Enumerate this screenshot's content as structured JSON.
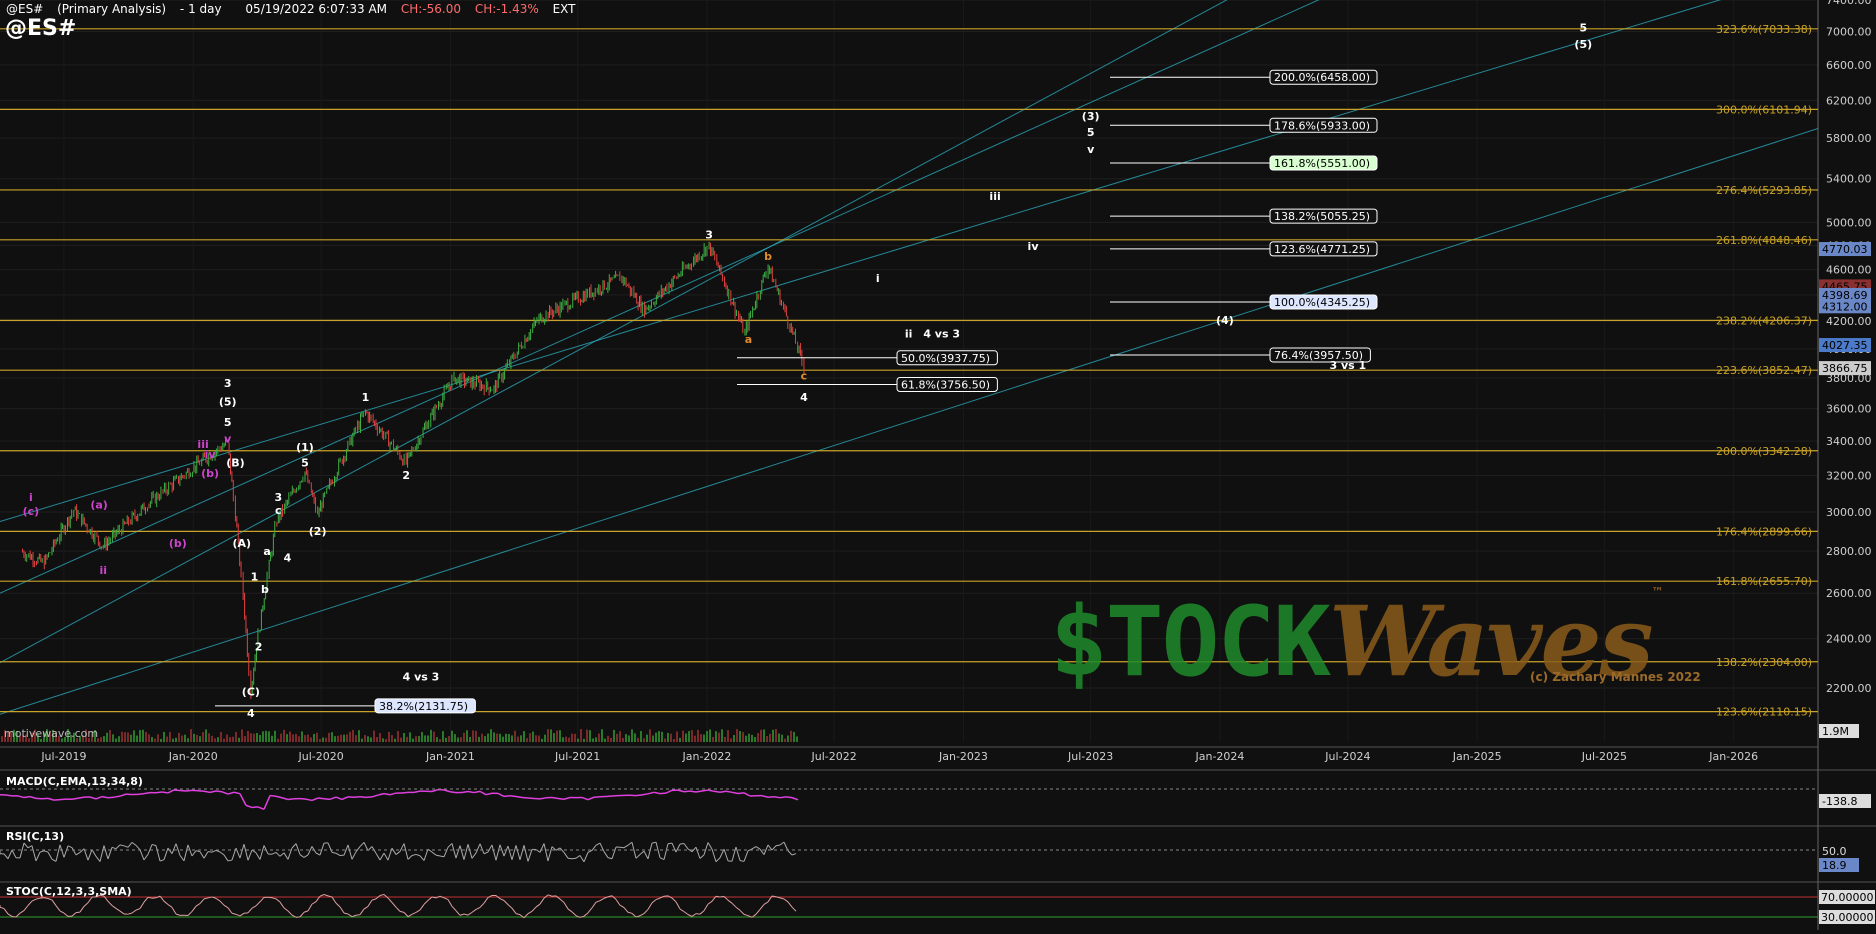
{
  "header": {
    "symbol": "@ES#",
    "study": "(Primary Analysis)",
    "interval": "1 day",
    "timestamp": "05/19/2022 6:07:33 AM",
    "change": "CH:-56.00",
    "change_pct": "CH:-1.43%",
    "session": "EXT",
    "big_symbol": "@ES#"
  },
  "source_label": "motivewave.com",
  "brand": {
    "left": "$TOCK",
    "right": "Waves",
    "tm": "™",
    "copyright": "(c) Zachary Mannes 2022"
  },
  "colors": {
    "background": "#101010",
    "fib_line": "#c9a227",
    "channel": "#2aa7b8",
    "bull_candle": "#3cb043",
    "bear_candle": "#e04040",
    "macd": "#e040e0",
    "grid": "#222222"
  },
  "chart_data": {
    "type": "candlestick",
    "y_scale": "log",
    "ylim": [
      2000,
      7400
    ],
    "x_axis": {
      "ticks": [
        "Jul-2019",
        "Jan-2020",
        "Jul-2020",
        "Jan-2021",
        "Jul-2021",
        "Jan-2022",
        "Jul-2022",
        "Jan-2023",
        "Jul-2023",
        "Jan-2024",
        "Jul-2024",
        "Jan-2025",
        "Jul-2025",
        "Jan-2026"
      ]
    },
    "y_axis": {
      "ticks": [
        2200,
        2400,
        2600,
        2800,
        3000,
        3200,
        3400,
        3600,
        3800,
        4000,
        4200,
        4400,
        4600,
        4800,
        5000,
        5400,
        5800,
        6200,
        6600,
        7000,
        7400
      ],
      "tick_labels": [
        "2200.00",
        "2400.00",
        "2600.00",
        "2800.00",
        "3000.00",
        "3200.00",
        "3400.00",
        "3600.00",
        "3800.00",
        "4000.00",
        "4200.00",
        "4400.00",
        "4600.00",
        "4800.00",
        "5000.00",
        "5400.00",
        "5800.00",
        "6200.00",
        "6600.00",
        "7000.00",
        "7400.00"
      ]
    },
    "price_path": [
      [
        "2019-05-01",
        2800
      ],
      [
        "2019-06-03",
        2740
      ],
      [
        "2019-07-15",
        3010
      ],
      [
        "2019-08-26",
        2825
      ],
      [
        "2019-10-28",
        3040
      ],
      [
        "2019-12-31",
        3240
      ],
      [
        "2020-02-19",
        3390
      ],
      [
        "2020-03-23",
        2190
      ],
      [
        "2020-04-29",
        2950
      ],
      [
        "2020-06-08",
        3220
      ],
      [
        "2020-06-26",
        2990
      ],
      [
        "2020-09-02",
        3580
      ],
      [
        "2020-10-30",
        3270
      ],
      [
        "2021-01-06",
        3800
      ],
      [
        "2021-03-04",
        3730
      ],
      [
        "2021-05-07",
        4220
      ],
      [
        "2021-09-02",
        4540
      ],
      [
        "2021-10-04",
        4280
      ],
      [
        "2022-01-04",
        4800
      ],
      [
        "2022-02-24",
        4110
      ],
      [
        "2022-03-29",
        4630
      ],
      [
        "2022-05-19",
        3880
      ]
    ],
    "fib_levels": [
      {
        "label": "323.6%(7033.38)",
        "value": 7033.38
      },
      {
        "label": "300.0%(6101.94)",
        "value": 6101.94
      },
      {
        "label": "276.4%(5293.85)",
        "value": 5293.85
      },
      {
        "label": "261.8%(4848.46)",
        "value": 4848.46
      },
      {
        "label": "238.2%(4206.37)",
        "value": 4206.37
      },
      {
        "label": "223.6%(3852.47)",
        "value": 3852.47
      },
      {
        "label": "200.0%(3342.28)",
        "value": 3342.28
      },
      {
        "label": "176.4%(2899.66)",
        "value": 2899.66
      },
      {
        "label": "161.8%(2655.70)",
        "value": 2655.7
      },
      {
        "label": "138.2%(2304.00)",
        "value": 2304.0
      },
      {
        "label": "123.6%(2110.15)",
        "value": 2110.15
      }
    ],
    "targets": [
      {
        "label": "200.0%(6458.00)",
        "value": 6458.0,
        "highlight": false
      },
      {
        "label": "178.6%(5933.00)",
        "value": 5933.0,
        "highlight": false
      },
      {
        "label": "161.8%(5551.00)",
        "value": 5551.0,
        "highlight": true
      },
      {
        "label": "138.2%(5055.25)",
        "value": 5055.25,
        "highlight": false
      },
      {
        "label": "123.6%(4771.25)",
        "value": 4771.25,
        "highlight": false
      },
      {
        "label": "100.0%(4345.25)",
        "value": 4345.25,
        "highlight": "blue"
      },
      {
        "label": "76.4%(3957.50)",
        "value": 3957.5,
        "highlight": false
      }
    ],
    "retracements": [
      {
        "label": "50.0%(3937.75)",
        "value": 3937.75
      },
      {
        "label": "61.8%(3756.50)",
        "value": 3756.5
      },
      {
        "label": "38.2%(2131.75)",
        "value": 2131.75
      }
    ],
    "price_badges": [
      {
        "label": "4770.03",
        "value": 4770.03,
        "color": "#6a88c8"
      },
      {
        "label": "4465.75",
        "value": 4465.75,
        "color": "#8a3030"
      },
      {
        "label": "4398.69",
        "value": 4398.69,
        "color": "#6a88c8"
      },
      {
        "label": "4312.00",
        "value": 4312.0,
        "color": "#6a88c8"
      },
      {
        "label": "4027.35",
        "value": 4027.35,
        "color": "#4a7ac8"
      },
      {
        "label": "3866.75",
        "value": 3866.75,
        "color": "#cccccc"
      }
    ],
    "wave_labels": [
      {
        "text": "3",
        "date": "2022-01-04",
        "value": 4860,
        "color": "#ffffff"
      },
      {
        "text": "b",
        "date": "2022-03-29",
        "value": 4680,
        "color": "#e08a2a"
      },
      {
        "text": "a",
        "date": "2022-03-01",
        "value": 4040,
        "color": "#e08a2a"
      },
      {
        "text": "c",
        "date": "2022-05-19",
        "value": 3790,
        "color": "#e08a2a"
      },
      {
        "text": "4",
        "date": "2022-05-19",
        "value": 3650,
        "color": "#ffffff"
      },
      {
        "text": "i",
        "date": "2022-09-01",
        "value": 4500,
        "color": "#ffffff"
      },
      {
        "text": "ii",
        "date": "2022-10-15",
        "value": 4080,
        "color": "#ffffff"
      },
      {
        "text": "4 vs 3",
        "date": "2022-12-01",
        "value": 4080,
        "color": "#ffffff"
      },
      {
        "text": "iii",
        "date": "2023-02-15",
        "value": 5200,
        "color": "#ffffff"
      },
      {
        "text": "iv",
        "date": "2023-04-10",
        "value": 4760,
        "color": "#ffffff"
      },
      {
        "text": "(3)",
        "date": "2023-07-01",
        "value": 5990,
        "color": "#ffffff"
      },
      {
        "text": "5",
        "date": "2023-07-01",
        "value": 5820,
        "color": "#ffffff"
      },
      {
        "text": "v",
        "date": "2023-07-01",
        "value": 5650,
        "color": "#ffffff"
      },
      {
        "text": "(4)",
        "date": "2024-01-08",
        "value": 4180,
        "color": "#ffffff"
      },
      {
        "text": "3 vs 1",
        "date": "2024-07-01",
        "value": 3860,
        "color": "#ffffff"
      },
      {
        "text": "5",
        "date": "2025-06-01",
        "value": 7000,
        "color": "#ffffff"
      },
      {
        "text": "(5)",
        "date": "2025-06-01",
        "value": 6800,
        "color": "#ffffff"
      },
      {
        "text": "3",
        "date": "2020-02-19",
        "value": 3740,
        "color": "#ffffff"
      },
      {
        "text": "(5)",
        "date": "2020-02-19",
        "value": 3620,
        "color": "#ffffff"
      },
      {
        "text": "5",
        "date": "2020-02-19",
        "value": 3490,
        "color": "#ffffff"
      },
      {
        "text": "v",
        "date": "2020-02-19",
        "value": 3390,
        "color": "#cc44cc"
      },
      {
        "text": "iii",
        "date": "2020-01-15",
        "value": 3360,
        "color": "#cc44cc"
      },
      {
        "text": "iv",
        "date": "2020-01-25",
        "value": 3300,
        "color": "#cc44cc"
      },
      {
        "text": "(b)",
        "date": "2020-01-25",
        "value": 3190,
        "color": "#cc44cc"
      },
      {
        "text": "(a)",
        "date": "2019-08-20",
        "value": 3020,
        "color": "#cc44cc"
      },
      {
        "text": "i",
        "date": "2019-05-15",
        "value": 3060,
        "color": "#cc44cc"
      },
      {
        "text": "(c)",
        "date": "2019-05-15",
        "value": 2985,
        "color": "#cc44cc"
      },
      {
        "text": "ii",
        "date": "2019-08-26",
        "value": 2690,
        "color": "#cc44cc"
      },
      {
        "text": "(b)",
        "date": "2019-12-10",
        "value": 2820,
        "color": "#cc44cc"
      },
      {
        "text": "(B)",
        "date": "2020-03-01",
        "value": 3250,
        "color": "#ffffff"
      },
      {
        "text": "(A)",
        "date": "2020-03-10",
        "value": 2820,
        "color": "#ffffff"
      },
      {
        "text": "1",
        "date": "2020-03-28",
        "value": 2660,
        "color": "#ffffff"
      },
      {
        "text": "2",
        "date": "2020-04-03",
        "value": 2350,
        "color": "#ffffff"
      },
      {
        "text": "(C)",
        "date": "2020-03-23",
        "value": 2170,
        "color": "#ffffff"
      },
      {
        "text": "4",
        "date": "2020-03-23",
        "value": 2090,
        "color": "#ffffff"
      },
      {
        "text": "3",
        "date": "2020-05-01",
        "value": 3060,
        "color": "#ffffff"
      },
      {
        "text": "c",
        "date": "2020-05-01",
        "value": 2990,
        "color": "#ffffff"
      },
      {
        "text": "a",
        "date": "2020-04-15",
        "value": 2780,
        "color": "#ffffff"
      },
      {
        "text": "b",
        "date": "2020-04-12",
        "value": 2600,
        "color": "#ffffff"
      },
      {
        "text": "4",
        "date": "2020-05-14",
        "value": 2750,
        "color": "#ffffff"
      },
      {
        "text": "(1)",
        "date": "2020-06-08",
        "value": 3340,
        "color": "#ffffff"
      },
      {
        "text": "5",
        "date": "2020-06-08",
        "value": 3250,
        "color": "#ffffff"
      },
      {
        "text": "(2)",
        "date": "2020-06-26",
        "value": 2880,
        "color": "#ffffff"
      },
      {
        "text": "1",
        "date": "2020-09-02",
        "value": 3650,
        "color": "#ffffff"
      },
      {
        "text": "2",
        "date": "2020-10-30",
        "value": 3180,
        "color": "#ffffff"
      },
      {
        "text": "4 vs 3",
        "date": "2020-11-20",
        "value": 2230,
        "color": "#ffffff"
      }
    ],
    "indicators": [
      {
        "label": "MACD(C,EMA,13,34,8)",
        "value_label": "-138.8"
      },
      {
        "label": "RSI(C,13)",
        "value_label": "18.9",
        "ref_label": "50.0"
      },
      {
        "label": "STOC(C,12,3,3,SMA)",
        "upper_label": "70.00000",
        "lower_label": "30.00000"
      }
    ],
    "volume_label": "1.9M"
  }
}
